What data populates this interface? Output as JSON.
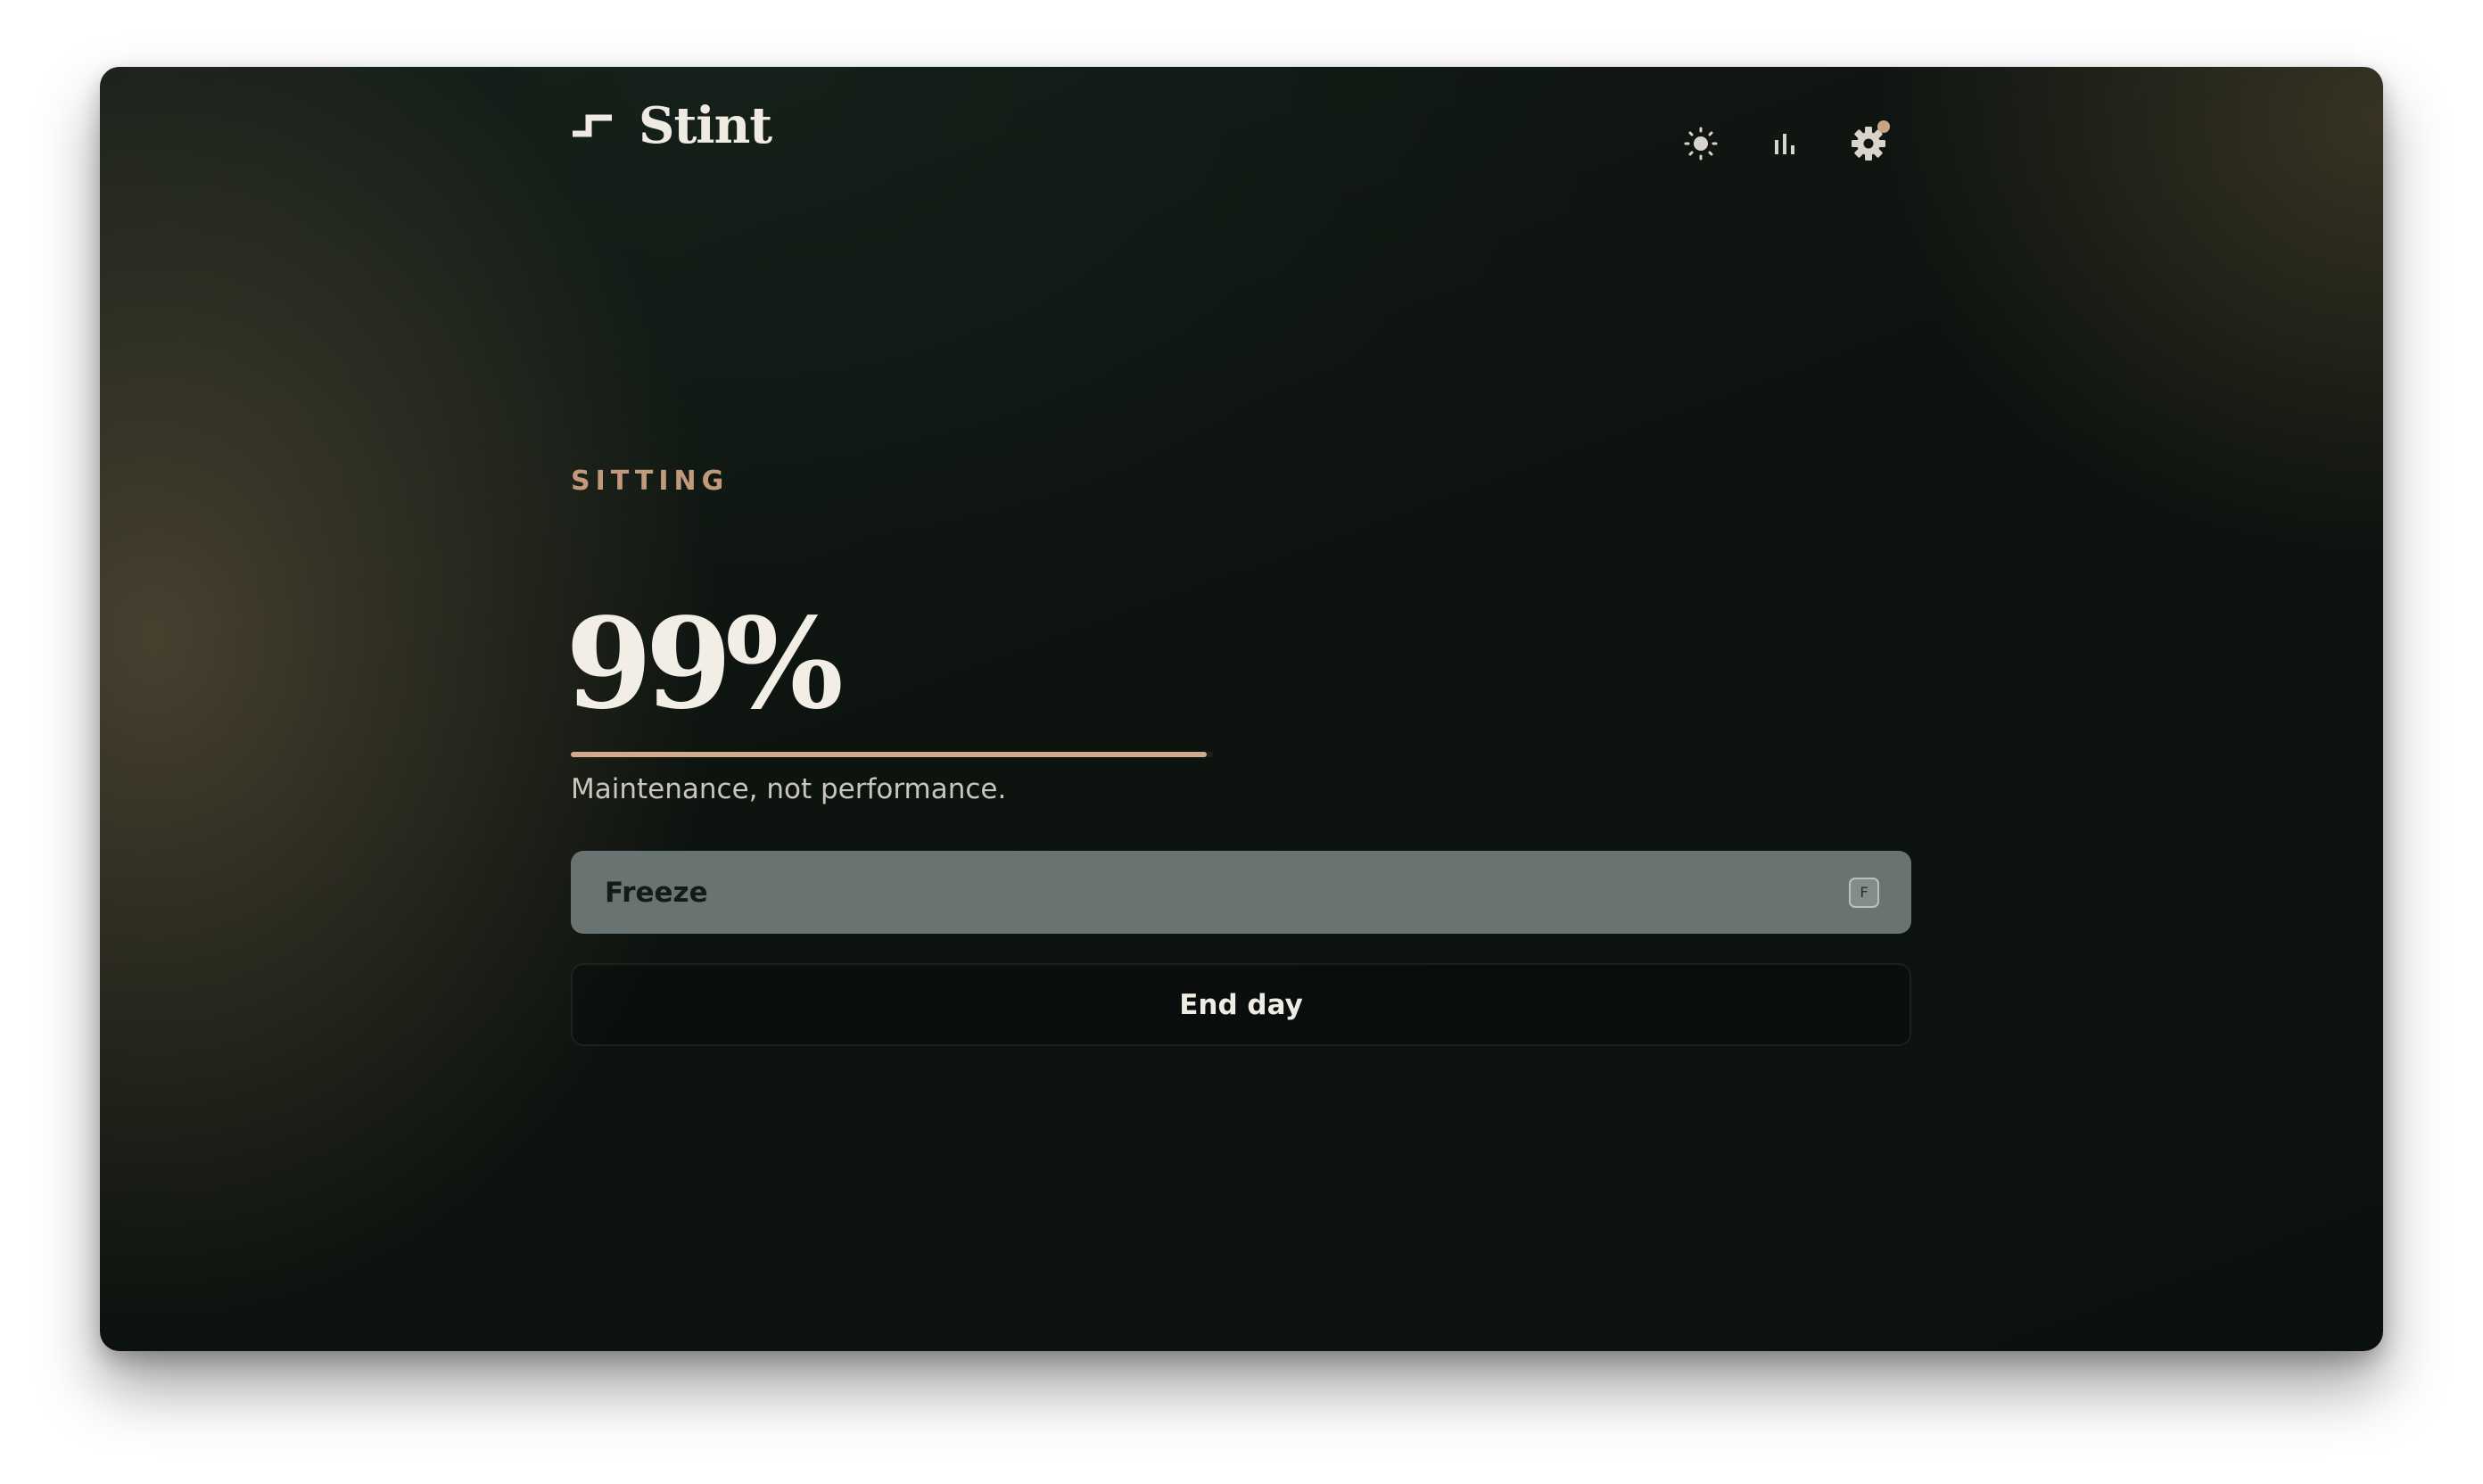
{
  "app": {
    "name": "Stint"
  },
  "header": {
    "icons": [
      {
        "name": "sun-icon",
        "label": "theme"
      },
      {
        "name": "bar-chart-icon",
        "label": "stats"
      },
      {
        "name": "gear-icon",
        "label": "settings",
        "has_notification": true
      }
    ]
  },
  "main": {
    "status_label": "SITTING",
    "percent_text": "99%",
    "progress_fraction": 0.99,
    "tagline": "Maintenance, not performance.",
    "freeze_button": {
      "label": "Freeze",
      "shortcut": "F"
    },
    "end_day_button": {
      "label": "End day"
    }
  },
  "colors": {
    "accent": "#d2ab8c",
    "status_label": "#c29a7b",
    "freeze_bg": "#687372",
    "notification_dot": "#caa485"
  }
}
